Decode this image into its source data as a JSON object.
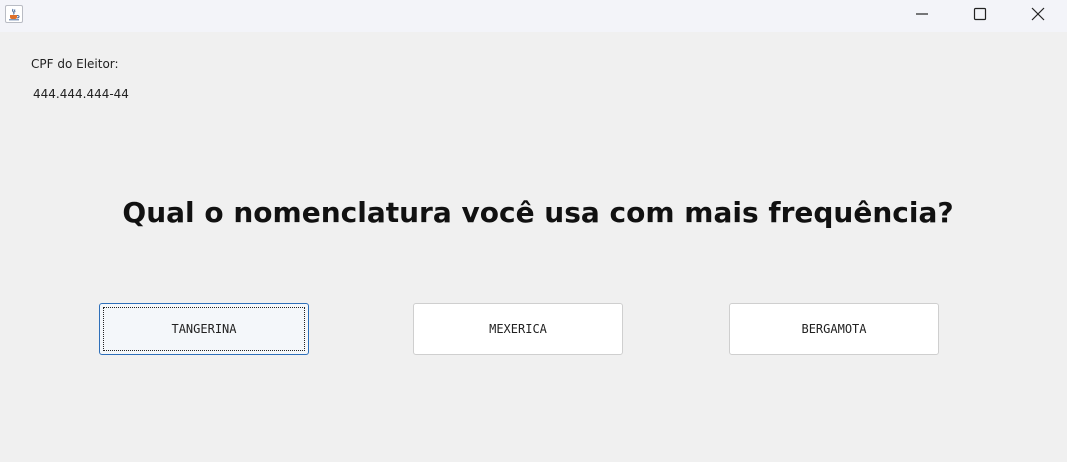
{
  "window": {
    "icon": "java-cup-icon",
    "controls": {
      "minimize_icon": "minimize-icon",
      "maximize_icon": "maximize-icon",
      "close_icon": "close-icon"
    }
  },
  "voter": {
    "label": "CPF do Eleitor:",
    "cpf": "444.444.444-44"
  },
  "question": "Qual o nomenclatura você usa com mais frequência?",
  "options": [
    {
      "label": "TANGERINA",
      "focused": true
    },
    {
      "label": "MEXERICA",
      "focused": false
    },
    {
      "label": "BERGAMOTA",
      "focused": false
    }
  ],
  "colors": {
    "background": "#f0f0f0",
    "titlebar": "#f3f4f9",
    "focus_border": "#2e6fb9"
  }
}
